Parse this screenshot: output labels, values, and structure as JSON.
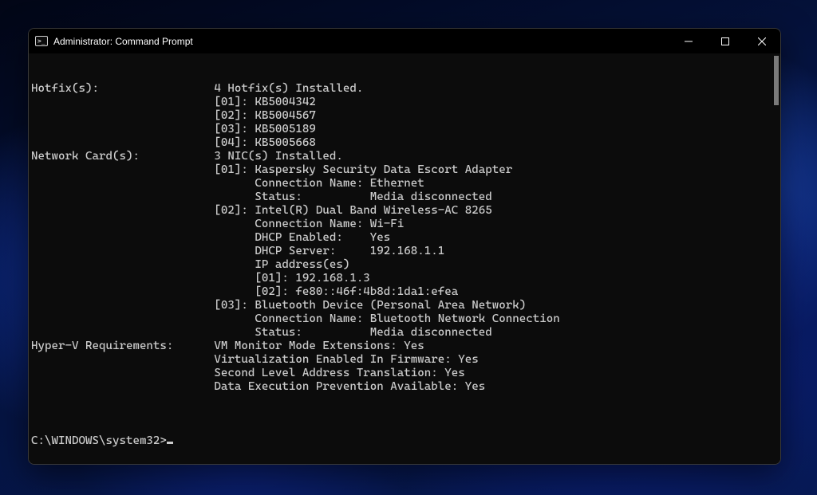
{
  "window": {
    "title": "Administrator: Command Prompt"
  },
  "terminal": {
    "lines": [
      "Hotfix(s):                 4 Hotfix(s) Installed.",
      "                           [01]: KB5004342",
      "                           [02]: KB5004567",
      "                           [03]: KB5005189",
      "                           [04]: KB5005668",
      "Network Card(s):           3 NIC(s) Installed.",
      "                           [01]: Kaspersky Security Data Escort Adapter",
      "                                 Connection Name: Ethernet",
      "                                 Status:          Media disconnected",
      "                           [02]: Intel(R) Dual Band Wireless-AC 8265",
      "                                 Connection Name: Wi-Fi",
      "                                 DHCP Enabled:    Yes",
      "                                 DHCP Server:     192.168.1.1",
      "                                 IP address(es)",
      "                                 [01]: 192.168.1.3",
      "                                 [02]: fe80::46f:4b8d:1da1:efea",
      "                           [03]: Bluetooth Device (Personal Area Network)",
      "                                 Connection Name: Bluetooth Network Connection",
      "                                 Status:          Media disconnected",
      "Hyper-V Requirements:      VM Monitor Mode Extensions: Yes",
      "                           Virtualization Enabled In Firmware: Yes",
      "                           Second Level Address Translation: Yes",
      "                           Data Execution Prevention Available: Yes",
      ""
    ],
    "prompt": "C:\\WINDOWS\\system32>"
  }
}
